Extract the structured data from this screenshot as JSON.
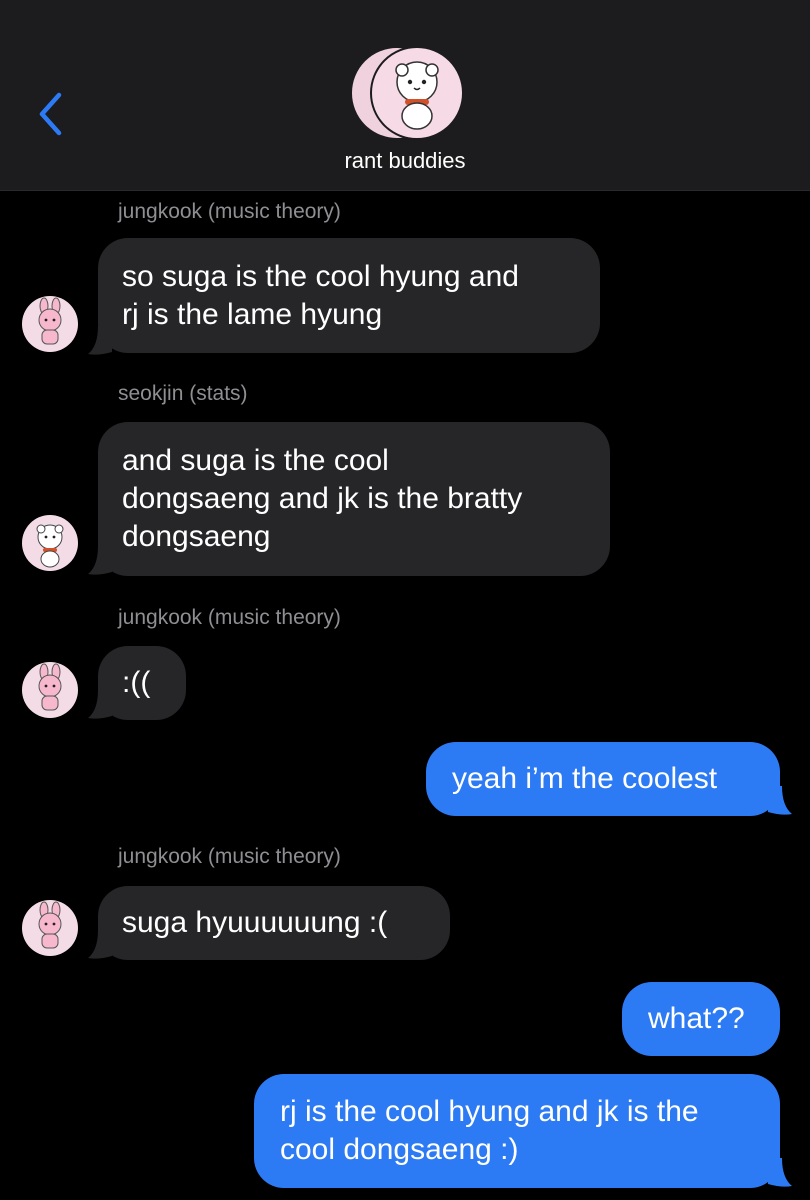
{
  "header": {
    "title": "rant buddies",
    "back_icon": "chevron-left-icon",
    "accent": "#2d7bf4"
  },
  "messages": [
    {
      "sender": "jungkook (music theory)",
      "lines": [
        "so suga is the cool hyung and",
        "rj is the lame hyung"
      ],
      "avatar": "cooky-avatar"
    },
    {
      "sender": "seokjin (stats)",
      "lines": [
        "and suga is the cool",
        "dongsaeng and jk is the bratty",
        "dongsaeng"
      ],
      "avatar": "rj-avatar"
    },
    {
      "sender": "jungkook (music theory)",
      "lines": [
        ":(("
      ],
      "avatar": "cooky-avatar"
    },
    {
      "sender": "",
      "lines": [
        "yeah i’m the coolest"
      ],
      "outgoing": true
    },
    {
      "sender": "jungkook (music theory)",
      "lines": [
        "suga hyuuuuuung :("
      ],
      "avatar": "cooky-avatar"
    },
    {
      "sender": "",
      "lines": [
        "what??"
      ],
      "outgoing": true
    },
    {
      "sender": "",
      "lines": [
        "rj is the cool hyung and jk is the",
        "cool dongsaeng :)"
      ],
      "outgoing": true
    }
  ],
  "colors": {
    "incoming_bubble": "#262629",
    "outgoing_bubble": "#2d7bf4",
    "sender_text": "#8e8e93"
  }
}
